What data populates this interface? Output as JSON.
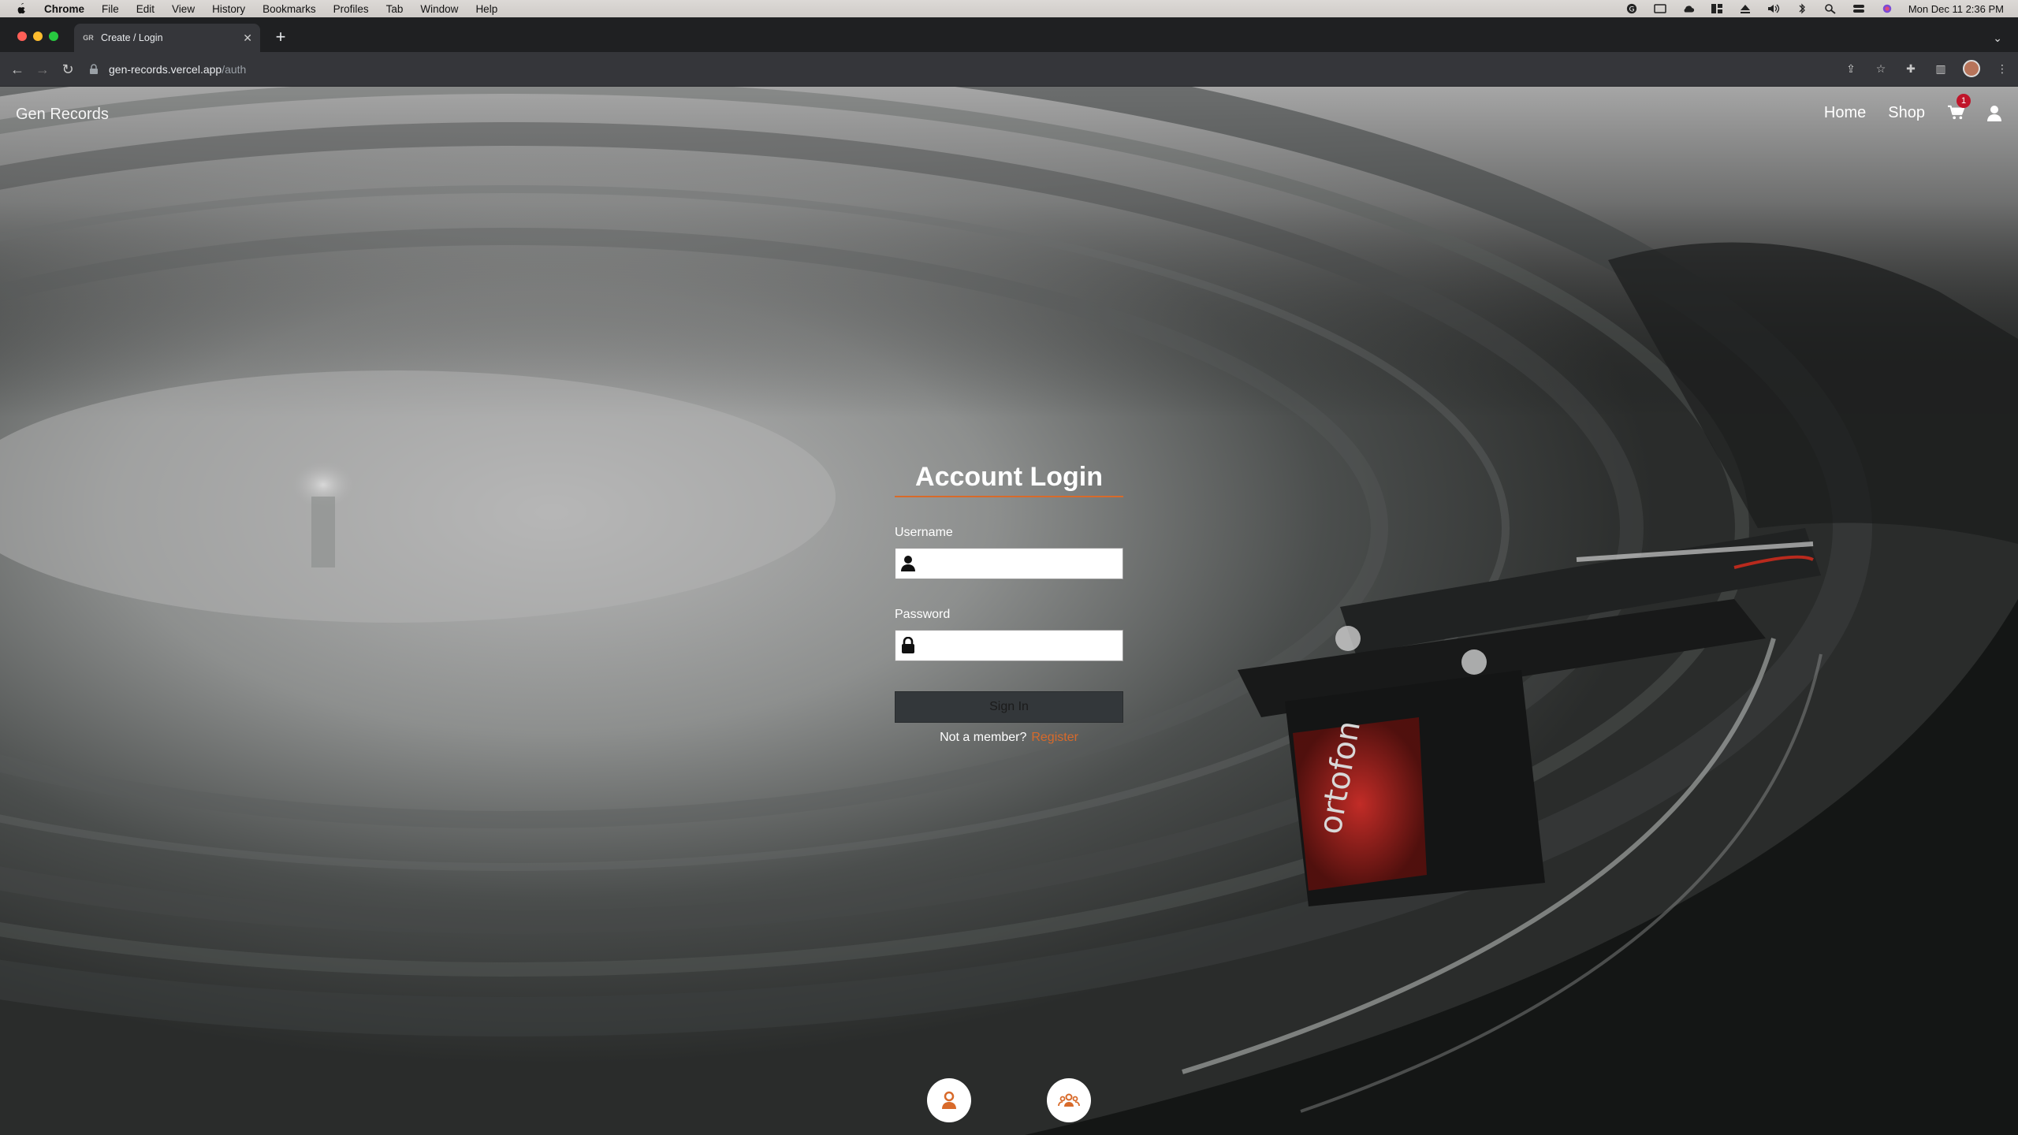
{
  "menubar": {
    "app": "Chrome",
    "items": [
      "File",
      "Edit",
      "View",
      "History",
      "Bookmarks",
      "Profiles",
      "Tab",
      "Window",
      "Help"
    ],
    "clock": "Mon Dec 11  2:36 PM"
  },
  "browser": {
    "tab_title": "Create / Login",
    "tab_favicon": "GR",
    "url_host": "gen-records.vercel.app",
    "url_path": "/auth"
  },
  "site": {
    "brand": "Gen Records",
    "nav": {
      "home": "Home",
      "shop": "Shop"
    },
    "cart_count": "1"
  },
  "login": {
    "title": "Account Login",
    "username_label": "Username",
    "password_label": "Password",
    "signin_label": "Sign In",
    "not_member": "Not a member?",
    "register_label": "Register"
  },
  "colors": {
    "accent": "#d86a2a",
    "badge": "#c0152a",
    "button": "#33373a"
  },
  "icons": {
    "bottom_left": "user-icon",
    "bottom_right": "users-group-icon"
  }
}
